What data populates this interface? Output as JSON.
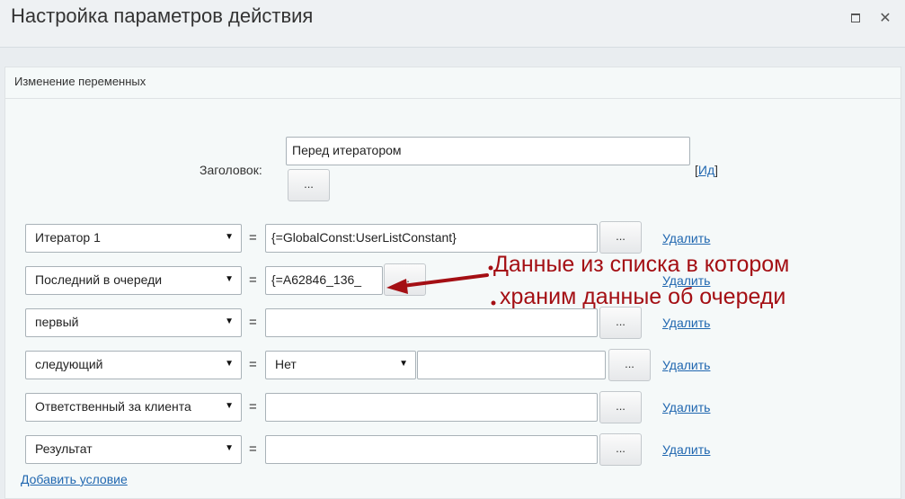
{
  "window": {
    "title": "Настройка параметров действия",
    "maximize_icon": "maximize-icon",
    "close_icon": "close-icon",
    "close_glyph": "✕"
  },
  "panel": {
    "header": "Изменение переменных",
    "caption_label": "Заголовок:",
    "caption_value": "Перед итератором",
    "caption_button": "...",
    "id_link_prefix": "[",
    "id_link": "Ид",
    "id_link_suffix": "]"
  },
  "rows": [
    {
      "variable": "Итератор 1",
      "eq": "=",
      "value": "{=GlobalConst:UserListConstant}",
      "button": "...",
      "delete": "Удалить"
    },
    {
      "variable": "Последний в очереди",
      "eq": "=",
      "value": "{=A62846_136_",
      "button": "...",
      "delete": "Удалить"
    },
    {
      "variable": "первый",
      "eq": "=",
      "value": "",
      "button": "...",
      "delete": "Удалить"
    },
    {
      "variable": "следующий",
      "eq": "=",
      "select_value": "Нет",
      "value": "",
      "button": "...",
      "delete": "Удалить"
    },
    {
      "variable": "Ответственный за клиента",
      "eq": "=",
      "value": "",
      "button": "...",
      "delete": "Удалить"
    },
    {
      "variable": "Результат",
      "eq": "=",
      "value": "",
      "button": "...",
      "delete": "Удалить"
    }
  ],
  "add_condition": "Добавить условие",
  "annotation": {
    "line1": "Данные из списка в котором",
    "line2": "храним данные об очереди",
    "color": "#a40f14"
  },
  "dropdown_arrow": "▼"
}
